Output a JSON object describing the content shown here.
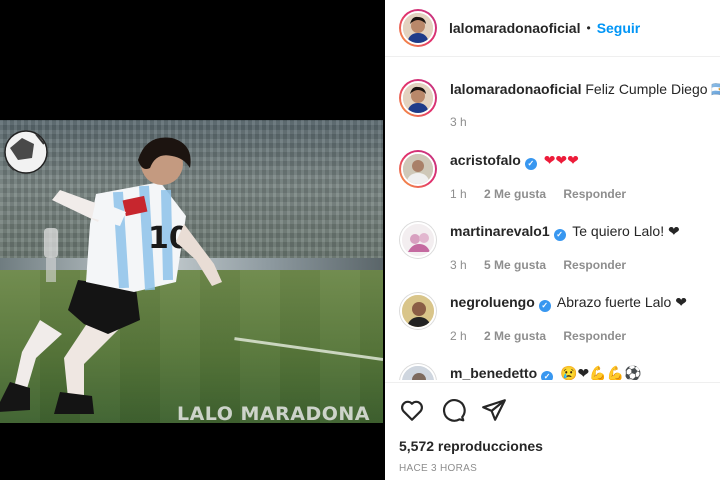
{
  "post": {
    "owner": "lalomaradonaoficial",
    "separator": "•",
    "follow_label": "Seguir",
    "media_watermark": "LALO MARADONA",
    "caption": {
      "user": "lalomaradonaoficial",
      "text": "Feliz Cumple Diego 🇦🇷",
      "time": "3 h"
    }
  },
  "comments": [
    {
      "user": "acristofalo",
      "verified": true,
      "text": "❤❤❤",
      "time": "1 h",
      "likes": "2 Me gusta",
      "reply": "Responder"
    },
    {
      "user": "martinarevalo1",
      "verified": true,
      "text": "Te quiero Lalo! ❤",
      "time": "3 h",
      "likes": "5 Me gusta",
      "reply": "Responder"
    },
    {
      "user": "negroluengo",
      "verified": true,
      "text": "Abrazo fuerte Lalo ❤",
      "time": "2 h",
      "likes": "2 Me gusta",
      "reply": "Responder"
    },
    {
      "user": "m_benedetto",
      "verified": true,
      "text": "😢❤💪💪⚽",
      "time": "",
      "likes": "",
      "reply": ""
    }
  ],
  "actions": {
    "icons": [
      "heart-icon",
      "comment-icon",
      "share-icon"
    ],
    "views": "5,572 reproducciones",
    "posted": "HACE 3 HORAS"
  },
  "colors": {
    "accent": "#0095f6",
    "verified": "#3897f0",
    "heart": "#ed1c3a",
    "muted": "#8e8e8e"
  }
}
